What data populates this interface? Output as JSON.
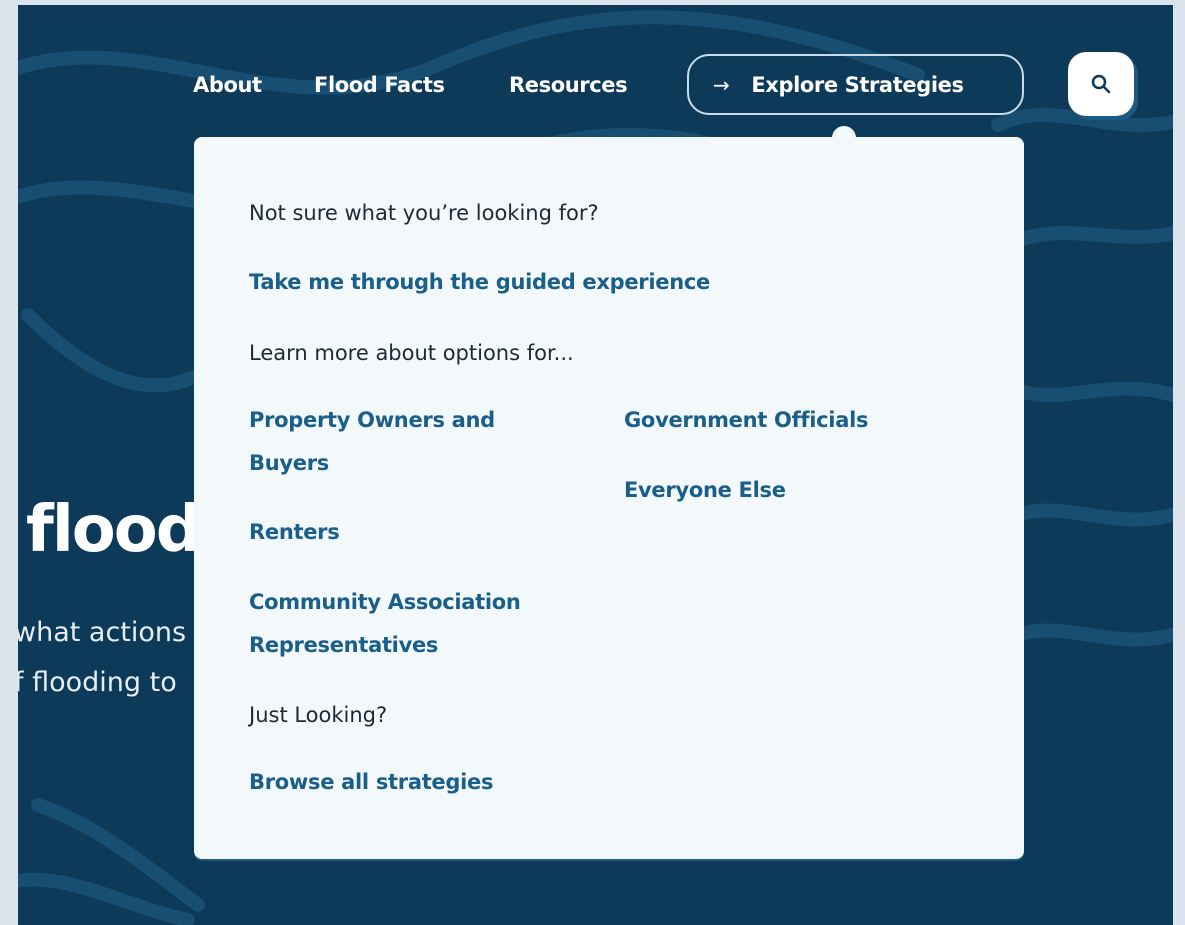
{
  "nav": {
    "about": "About",
    "flood_facts": "Flood Facts",
    "resources": "Resources",
    "explore_arrow": "→",
    "explore": "Explore Strategies"
  },
  "search": {
    "icon": "search-icon"
  },
  "hero": {
    "title_fragment": "flood",
    "line1": "what actions",
    "line2": "f flooding to"
  },
  "dropdown": {
    "intro": "Not sure what you’re looking for?",
    "guided_link": "Take me through the guided experience",
    "options_heading": "Learn more about options for...",
    "audiences": {
      "property_owners": "Property Owners and Buyers",
      "renters": "Renters",
      "community_reps": "Community Association Representatives",
      "government": "Government Officials",
      "everyone_else": "Everyone Else"
    },
    "just_looking": "Just Looking?",
    "browse_link": "Browse all strategies"
  },
  "colors": {
    "background": "#0c3a58",
    "link": "#1a5f8a",
    "panel": "#f3f8fb"
  }
}
